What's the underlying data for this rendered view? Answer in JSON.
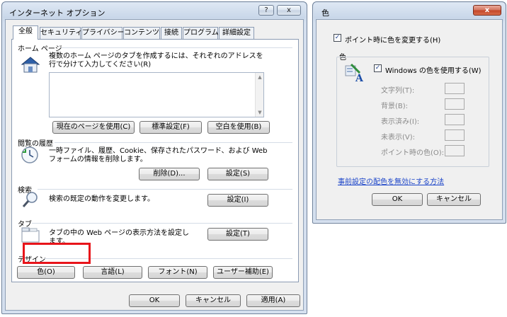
{
  "left_window": {
    "title": "インターネット オプション",
    "help_label": "?",
    "close_label": "x",
    "tabs": [
      {
        "label": "全般"
      },
      {
        "label": "セキュリティ"
      },
      {
        "label": "プライバシー"
      },
      {
        "label": "コンテンツ"
      },
      {
        "label": "接続"
      },
      {
        "label": "プログラム"
      },
      {
        "label": "詳細設定"
      }
    ],
    "home": {
      "heading": "ホーム ページ",
      "desc": "複数のホーム ページのタブを作成するには、それぞれのアドレスを行で分けて入力してください(R)",
      "use_current": "現在のページを使用(C)",
      "use_default": "標準設定(F)",
      "use_blank": "空白を使用(B)"
    },
    "history": {
      "heading": "閲覧の履歴",
      "desc": "一時ファイル、履歴、Cookie、保存されたパスワード、および Web フォームの情報を削除します。",
      "delete": "削除(D)...",
      "settings": "設定(S)"
    },
    "search": {
      "heading": "検索",
      "desc": "検索の既定の動作を変更します。",
      "settings": "設定(I)"
    },
    "tabs_section": {
      "heading": "タブ",
      "desc": "タブの中の Web ページの表示方法を設定します。",
      "settings": "設定(T)"
    },
    "design": {
      "heading": "デザイン",
      "colors": "色(O)",
      "languages": "言語(L)",
      "fonts": "フォント(N)",
      "accessibility": "ユーザー補助(E)"
    },
    "footer": {
      "ok": "OK",
      "cancel": "キャンセル",
      "apply": "適用(A)"
    }
  },
  "right_window": {
    "title": "色",
    "close_label": "x",
    "hover_checkbox": "ポイント時に色を変更する(H)",
    "group_label": "色",
    "use_windows_colors": "Windows の色を使用する(W)",
    "color_items": [
      {
        "label": "文字列(T):"
      },
      {
        "label": "背景(B):"
      },
      {
        "label": "表示済み(I):"
      },
      {
        "label": "未表示(V):"
      },
      {
        "label": "ポイント時の色(O):"
      }
    ],
    "link": "事前設定の配色を無効にする方法",
    "ok": "OK",
    "cancel": "キャンセル"
  },
  "colors": {
    "highlight": "#e8141a",
    "link": "#1a43c8"
  }
}
